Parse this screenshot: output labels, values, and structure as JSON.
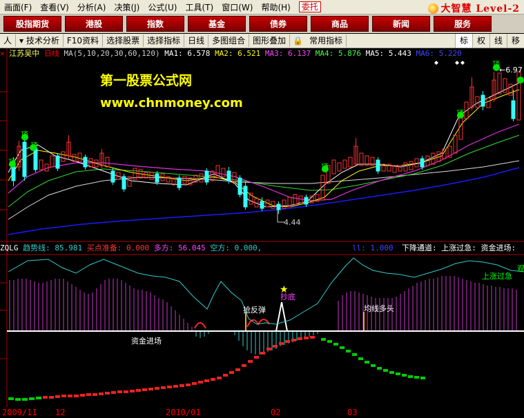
{
  "menu": {
    "items": [
      "画面(F)",
      "查看(V)",
      "分析(A)",
      "决策(J)",
      "公式(U)",
      "工具(T)",
      "窗口(W)",
      "帮助(H)"
    ],
    "weituo": "委托",
    "brand": "大智慧 Level-2"
  },
  "nav": {
    "buttons": [
      "股指期货",
      "港股",
      "指数",
      "基金",
      "债券",
      "商品",
      "新闻",
      "服务"
    ]
  },
  "toolbar": {
    "left_cut": "人",
    "items": [
      "技术分析",
      "F10资料",
      "选择股票",
      "选择指标",
      "日线",
      "多图组合",
      "图形叠加",
      "常用指标"
    ],
    "right": [
      "标",
      "权",
      "线",
      "移"
    ]
  },
  "price_panel": {
    "stock": "江苏吴中",
    "period": "日线",
    "ma_params": "MA(5,10,20,30,60,120)",
    "ma1": "MA1: 6.578",
    "ma2": "MA2: 6.521",
    "ma3": "MA3: 6.137",
    "ma4": "MA4: 5.876",
    "ma5": "MA5: 5.443",
    "ma6": "MA6: 5.220",
    "high_label": "6.97",
    "low_label": "4.44",
    "top_signal": "顶"
  },
  "watermark": {
    "line1": "第一股票公式网",
    "line2": "www.chnmoney.com"
  },
  "indicator_panel": {
    "name": "ZQLG",
    "trend": "趋势线: 85.981",
    "buy_ready": "买点准备: 0.000",
    "bull": "多方: 56.045",
    "bear": "空方: 0.000,",
    "extra": "下降通道: 上涨过急: 资金进场:",
    "partial_left": "ll: 1.000",
    "labels": {
      "rebound": "抢反弹",
      "bottom": "抄底",
      "ma_bull": "均线多头",
      "fund_in": "资金进场",
      "surge": "上涨过急",
      "right_cut": "观"
    }
  },
  "dates": [
    "2009/11",
    "12",
    "2010/01",
    "02",
    "03"
  ],
  "colors": {
    "up": "#ff3333",
    "down": "#33ffff",
    "ma1": "#ffffff",
    "ma2": "#ffff00",
    "ma3": "#ff00ff",
    "ma4": "#00ff00",
    "ma5": "#ffffff",
    "ma6": "#0000ff"
  }
}
